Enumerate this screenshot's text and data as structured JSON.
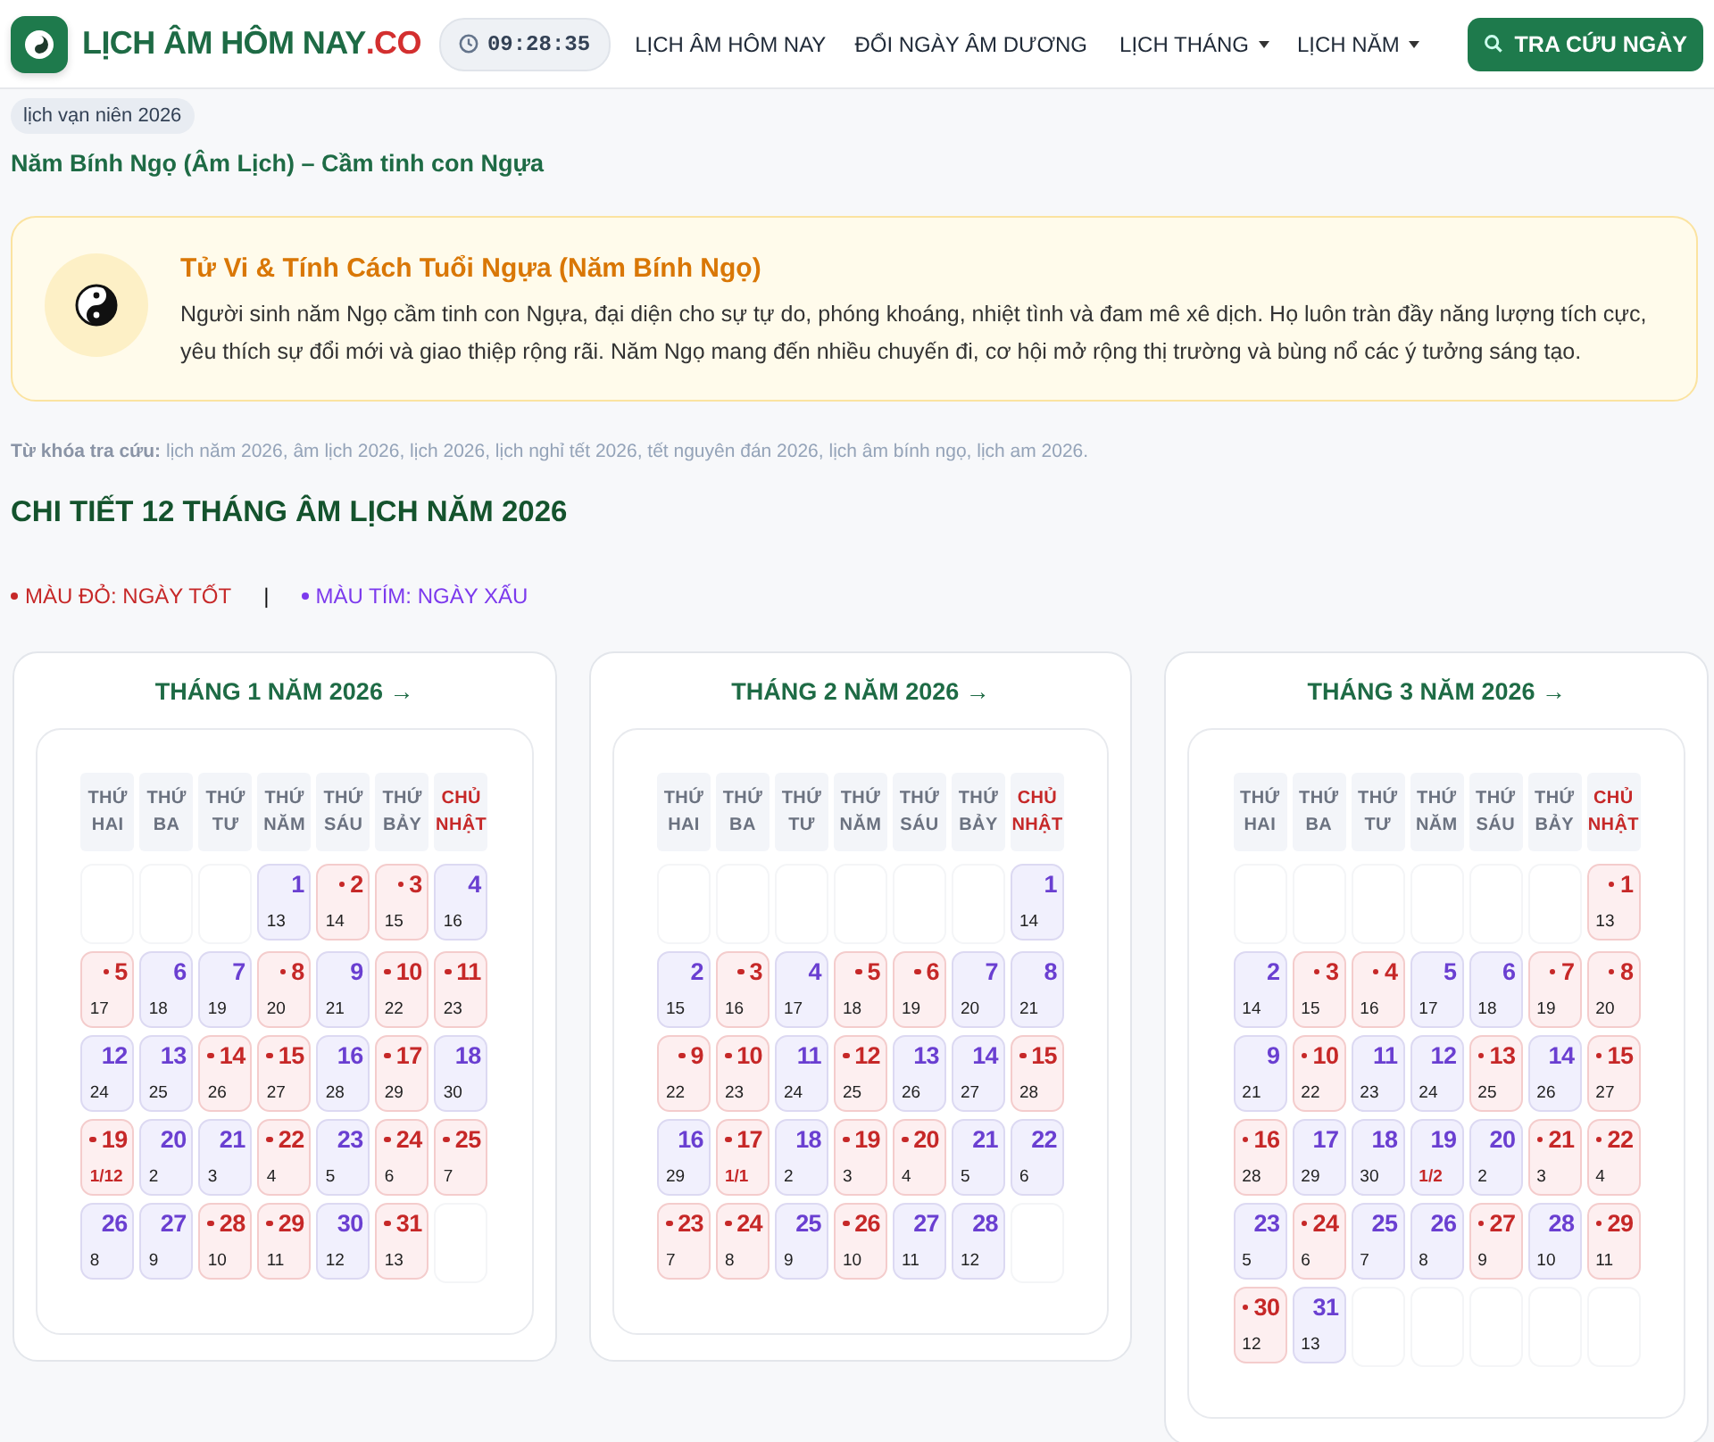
{
  "header": {
    "brand": {
      "name": "LỊCH ÂM HÔM NAY",
      "suffix": ".CO"
    },
    "clock": "09:28:35",
    "nav": [
      {
        "label": "LỊCH ÂM HÔM NAY",
        "kind": "link"
      },
      {
        "label": "ĐỔI NGÀY ÂM DƯƠNG",
        "kind": "link"
      },
      {
        "label": "LỊCH THÁNG",
        "kind": "dropdown"
      },
      {
        "label": "LỊCH NĂM",
        "kind": "dropdown"
      }
    ],
    "search_button": "TRA CỨU NGÀY"
  },
  "breadcrumb": "lịch vạn niên 2026",
  "subtitle": "Năm Bính Ngọ (Âm Lịch) – Cầm tinh con Ngựa",
  "info": {
    "title": "Tử Vi & Tính Cách Tuổi Ngựa (Năm Bính Ngọ)",
    "text": "Người sinh năm Ngọ cầm tinh con Ngựa, đại diện cho sự tự do, phóng khoáng, nhiệt tình và đam mê xê dịch. Họ luôn tràn đầy năng lượng tích cực, yêu thích sự đổi mới và giao thiệp rộng rãi. Năm Ngọ mang đến nhiều chuyến đi, cơ hội mở rộng thị trường và bùng nổ các ý tưởng sáng tạo."
  },
  "keywords": "**Từ khóa tra cứu:** lịch năm 2026, âm lịch 2026, lịch 2026, lịch nghỉ tết 2026, tết nguyên đán 2026, lịch âm bính ngọ, lịch am 2026.",
  "section_title": "CHI TIẾT 12 THÁNG ÂM LỊCH NĂM 2026",
  "legend": {
    "items": [
      {
        "label": "MÀU ĐỎ: NGÀY TỐT",
        "color": "#c62828"
      },
      {
        "label": "MÀU TÍM: NGÀY XẤU",
        "color": "#7c3aed"
      }
    ],
    "separator": "|"
  },
  "months": [
    {
      "title": "THÁNG 1 NĂM 2026 →",
      "weekdays": [
        {
          "label": "THỨ HAI",
          "holiday": false
        },
        {
          "label": "THỨ BA",
          "holiday": false
        },
        {
          "label": "THỨ TƯ",
          "holiday": false
        },
        {
          "label": "THỨ NĂM",
          "holiday": false
        },
        {
          "label": "THỨ SÁU",
          "holiday": false
        },
        {
          "label": "THỨ BẢY",
          "holiday": false
        },
        {
          "label": "CHỦ NHẬT",
          "holiday": true
        }
      ],
      "cells": [
        {
          "kind": "blank"
        },
        {
          "kind": "blank"
        },
        {
          "kind": "blank"
        },
        {
          "kind": "day",
          "solar": "1",
          "lunar": "13",
          "good": false,
          "lunar_first": false
        },
        {
          "kind": "day",
          "solar": "2",
          "lunar": "14",
          "good": true,
          "lunar_first": false
        },
        {
          "kind": "day",
          "solar": "3",
          "lunar": "15",
          "good": true,
          "lunar_first": false
        },
        {
          "kind": "day",
          "solar": "4",
          "lunar": "16",
          "good": false,
          "lunar_first": false
        },
        {
          "kind": "day",
          "solar": "5",
          "lunar": "17",
          "good": true,
          "lunar_first": false
        },
        {
          "kind": "day",
          "solar": "6",
          "lunar": "18",
          "good": false,
          "lunar_first": false
        },
        {
          "kind": "day",
          "solar": "7",
          "lunar": "19",
          "good": false,
          "lunar_first": false
        },
        {
          "kind": "day",
          "solar": "8",
          "lunar": "20",
          "good": true,
          "lunar_first": false
        },
        {
          "kind": "day",
          "solar": "9",
          "lunar": "21",
          "good": false,
          "lunar_first": false
        },
        {
          "kind": "day",
          "solar": "10",
          "lunar": "22",
          "good": true,
          "lunar_first": false
        },
        {
          "kind": "day",
          "solar": "11",
          "lunar": "23",
          "good": true,
          "lunar_first": false
        },
        {
          "kind": "day",
          "solar": "12",
          "lunar": "24",
          "good": false,
          "lunar_first": false
        },
        {
          "kind": "day",
          "solar": "13",
          "lunar": "25",
          "good": false,
          "lunar_first": false
        },
        {
          "kind": "day",
          "solar": "14",
          "lunar": "26",
          "good": true,
          "lunar_first": false
        },
        {
          "kind": "day",
          "solar": "15",
          "lunar": "27",
          "good": true,
          "lunar_first": false
        },
        {
          "kind": "day",
          "solar": "16",
          "lunar": "28",
          "good": false,
          "lunar_first": false
        },
        {
          "kind": "day",
          "solar": "17",
          "lunar": "29",
          "good": true,
          "lunar_first": false
        },
        {
          "kind": "day",
          "solar": "18",
          "lunar": "30",
          "good": false,
          "lunar_first": false
        },
        {
          "kind": "day",
          "solar": "19",
          "lunar": "1/12",
          "good": true,
          "lunar_first": true
        },
        {
          "kind": "day",
          "solar": "20",
          "lunar": "2",
          "good": false,
          "lunar_first": false
        },
        {
          "kind": "day",
          "solar": "21",
          "lunar": "3",
          "good": false,
          "lunar_first": false
        },
        {
          "kind": "day",
          "solar": "22",
          "lunar": "4",
          "good": true,
          "lunar_first": false
        },
        {
          "kind": "day",
          "solar": "23",
          "lunar": "5",
          "good": false,
          "lunar_first": false
        },
        {
          "kind": "day",
          "solar": "24",
          "lunar": "6",
          "good": true,
          "lunar_first": false
        },
        {
          "kind": "day",
          "solar": "25",
          "lunar": "7",
          "good": true,
          "lunar_first": false
        },
        {
          "kind": "day",
          "solar": "26",
          "lunar": "8",
          "good": false,
          "lunar_first": false
        },
        {
          "kind": "day",
          "solar": "27",
          "lunar": "9",
          "good": false,
          "lunar_first": false
        },
        {
          "kind": "day",
          "solar": "28",
          "lunar": "10",
          "good": true,
          "lunar_first": false
        },
        {
          "kind": "day",
          "solar": "29",
          "lunar": "11",
          "good": true,
          "lunar_first": false
        },
        {
          "kind": "day",
          "solar": "30",
          "lunar": "12",
          "good": false,
          "lunar_first": false
        },
        {
          "kind": "day",
          "solar": "31",
          "lunar": "13",
          "good": true,
          "lunar_first": false
        },
        {
          "kind": "blank"
        }
      ]
    },
    {
      "title": "THÁNG 2 NĂM 2026 →",
      "weekdays": [
        {
          "label": "THỨ HAI",
          "holiday": false
        },
        {
          "label": "THỨ BA",
          "holiday": false
        },
        {
          "label": "THỨ TƯ",
          "holiday": false
        },
        {
          "label": "THỨ NĂM",
          "holiday": false
        },
        {
          "label": "THỨ SÁU",
          "holiday": false
        },
        {
          "label": "THỨ BẢY",
          "holiday": false
        },
        {
          "label": "CHỦ NHẬT",
          "holiday": true
        }
      ],
      "cells": [
        {
          "kind": "blank"
        },
        {
          "kind": "blank"
        },
        {
          "kind": "blank"
        },
        {
          "kind": "blank"
        },
        {
          "kind": "blank"
        },
        {
          "kind": "blank"
        },
        {
          "kind": "day",
          "solar": "1",
          "lunar": "14",
          "good": false,
          "lunar_first": false
        },
        {
          "kind": "day",
          "solar": "2",
          "lunar": "15",
          "good": false,
          "lunar_first": false
        },
        {
          "kind": "day",
          "solar": "3",
          "lunar": "16",
          "good": true,
          "lunar_first": false
        },
        {
          "kind": "day",
          "solar": "4",
          "lunar": "17",
          "good": false,
          "lunar_first": false
        },
        {
          "kind": "day",
          "solar": "5",
          "lunar": "18",
          "good": true,
          "lunar_first": false
        },
        {
          "kind": "day",
          "solar": "6",
          "lunar": "19",
          "good": true,
          "lunar_first": false
        },
        {
          "kind": "day",
          "solar": "7",
          "lunar": "20",
          "good": false,
          "lunar_first": false
        },
        {
          "kind": "day",
          "solar": "8",
          "lunar": "21",
          "good": false,
          "lunar_first": false
        },
        {
          "kind": "day",
          "solar": "9",
          "lunar": "22",
          "good": true,
          "lunar_first": false
        },
        {
          "kind": "day",
          "solar": "10",
          "lunar": "23",
          "good": true,
          "lunar_first": false
        },
        {
          "kind": "day",
          "solar": "11",
          "lunar": "24",
          "good": false,
          "lunar_first": false
        },
        {
          "kind": "day",
          "solar": "12",
          "lunar": "25",
          "good": true,
          "lunar_first": false
        },
        {
          "kind": "day",
          "solar": "13",
          "lunar": "26",
          "good": false,
          "lunar_first": false
        },
        {
          "kind": "day",
          "solar": "14",
          "lunar": "27",
          "good": false,
          "lunar_first": false
        },
        {
          "kind": "day",
          "solar": "15",
          "lunar": "28",
          "good": true,
          "lunar_first": false
        },
        {
          "kind": "day",
          "solar": "16",
          "lunar": "29",
          "good": false,
          "lunar_first": false
        },
        {
          "kind": "day",
          "solar": "17",
          "lunar": "1/1",
          "good": true,
          "lunar_first": true
        },
        {
          "kind": "day",
          "solar": "18",
          "lunar": "2",
          "good": false,
          "lunar_first": false
        },
        {
          "kind": "day",
          "solar": "19",
          "lunar": "3",
          "good": true,
          "lunar_first": false
        },
        {
          "kind": "day",
          "solar": "20",
          "lunar": "4",
          "good": true,
          "lunar_first": false
        },
        {
          "kind": "day",
          "solar": "21",
          "lunar": "5",
          "good": false,
          "lunar_first": false
        },
        {
          "kind": "day",
          "solar": "22",
          "lunar": "6",
          "good": false,
          "lunar_first": false
        },
        {
          "kind": "day",
          "solar": "23",
          "lunar": "7",
          "good": true,
          "lunar_first": false
        },
        {
          "kind": "day",
          "solar": "24",
          "lunar": "8",
          "good": true,
          "lunar_first": false
        },
        {
          "kind": "day",
          "solar": "25",
          "lunar": "9",
          "good": false,
          "lunar_first": false
        },
        {
          "kind": "day",
          "solar": "26",
          "lunar": "10",
          "good": true,
          "lunar_first": false
        },
        {
          "kind": "day",
          "solar": "27",
          "lunar": "11",
          "good": false,
          "lunar_first": false
        },
        {
          "kind": "day",
          "solar": "28",
          "lunar": "12",
          "good": false,
          "lunar_first": false
        },
        {
          "kind": "blank"
        }
      ]
    },
    {
      "title": "THÁNG 3 NĂM 2026 →",
      "weekdays": [
        {
          "label": "THỨ HAI",
          "holiday": false
        },
        {
          "label": "THỨ BA",
          "holiday": false
        },
        {
          "label": "THỨ TƯ",
          "holiday": false
        },
        {
          "label": "THỨ NĂM",
          "holiday": false
        },
        {
          "label": "THỨ SÁU",
          "holiday": false
        },
        {
          "label": "THỨ BẢY",
          "holiday": false
        },
        {
          "label": "CHỦ NHẬT",
          "holiday": true
        }
      ],
      "cells": [
        {
          "kind": "blank"
        },
        {
          "kind": "blank"
        },
        {
          "kind": "blank"
        },
        {
          "kind": "blank"
        },
        {
          "kind": "blank"
        },
        {
          "kind": "blank"
        },
        {
          "kind": "day",
          "solar": "1",
          "lunar": "13",
          "good": true,
          "lunar_first": false
        },
        {
          "kind": "day",
          "solar": "2",
          "lunar": "14",
          "good": false,
          "lunar_first": false
        },
        {
          "kind": "day",
          "solar": "3",
          "lunar": "15",
          "good": true,
          "lunar_first": false
        },
        {
          "kind": "day",
          "solar": "4",
          "lunar": "16",
          "good": true,
          "lunar_first": false
        },
        {
          "kind": "day",
          "solar": "5",
          "lunar": "17",
          "good": false,
          "lunar_first": false
        },
        {
          "kind": "day",
          "solar": "6",
          "lunar": "18",
          "good": false,
          "lunar_first": false
        },
        {
          "kind": "day",
          "solar": "7",
          "lunar": "19",
          "good": true,
          "lunar_first": false
        },
        {
          "kind": "day",
          "solar": "8",
          "lunar": "20",
          "good": true,
          "lunar_first": false
        },
        {
          "kind": "day",
          "solar": "9",
          "lunar": "21",
          "good": false,
          "lunar_first": false
        },
        {
          "kind": "day",
          "solar": "10",
          "lunar": "22",
          "good": true,
          "lunar_first": false
        },
        {
          "kind": "day",
          "solar": "11",
          "lunar": "23",
          "good": false,
          "lunar_first": false
        },
        {
          "kind": "day",
          "solar": "12",
          "lunar": "24",
          "good": false,
          "lunar_first": false
        },
        {
          "kind": "day",
          "solar": "13",
          "lunar": "25",
          "good": true,
          "lunar_first": false
        },
        {
          "kind": "day",
          "solar": "14",
          "lunar": "26",
          "good": false,
          "lunar_first": false
        },
        {
          "kind": "day",
          "solar": "15",
          "lunar": "27",
          "good": true,
          "lunar_first": false
        },
        {
          "kind": "day",
          "solar": "16",
          "lunar": "28",
          "good": true,
          "lunar_first": false
        },
        {
          "kind": "day",
          "solar": "17",
          "lunar": "29",
          "good": false,
          "lunar_first": false
        },
        {
          "kind": "day",
          "solar": "18",
          "lunar": "30",
          "good": false,
          "lunar_first": false
        },
        {
          "kind": "day",
          "solar": "19",
          "lunar": "1/2",
          "good": false,
          "lunar_first": true
        },
        {
          "kind": "day",
          "solar": "20",
          "lunar": "2",
          "good": false,
          "lunar_first": false
        },
        {
          "kind": "day",
          "solar": "21",
          "lunar": "3",
          "good": true,
          "lunar_first": false
        },
        {
          "kind": "day",
          "solar": "22",
          "lunar": "4",
          "good": true,
          "lunar_first": false
        },
        {
          "kind": "day",
          "solar": "23",
          "lunar": "5",
          "good": false,
          "lunar_first": false
        },
        {
          "kind": "day",
          "solar": "24",
          "lunar": "6",
          "good": true,
          "lunar_first": false
        },
        {
          "kind": "day",
          "solar": "25",
          "lunar": "7",
          "good": false,
          "lunar_first": false
        },
        {
          "kind": "day",
          "solar": "26",
          "lunar": "8",
          "good": false,
          "lunar_first": false
        },
        {
          "kind": "day",
          "solar": "27",
          "lunar": "9",
          "good": true,
          "lunar_first": false
        },
        {
          "kind": "day",
          "solar": "28",
          "lunar": "10",
          "good": false,
          "lunar_first": false
        },
        {
          "kind": "day",
          "solar": "29",
          "lunar": "11",
          "good": true,
          "lunar_first": false
        },
        {
          "kind": "day",
          "solar": "30",
          "lunar": "12",
          "good": true,
          "lunar_first": false
        },
        {
          "kind": "day",
          "solar": "31",
          "lunar": "13",
          "good": false,
          "lunar_first": false
        },
        {
          "kind": "blank"
        },
        {
          "kind": "blank"
        },
        {
          "kind": "blank"
        },
        {
          "kind": "blank"
        },
        {
          "kind": "blank"
        }
      ]
    }
  ]
}
